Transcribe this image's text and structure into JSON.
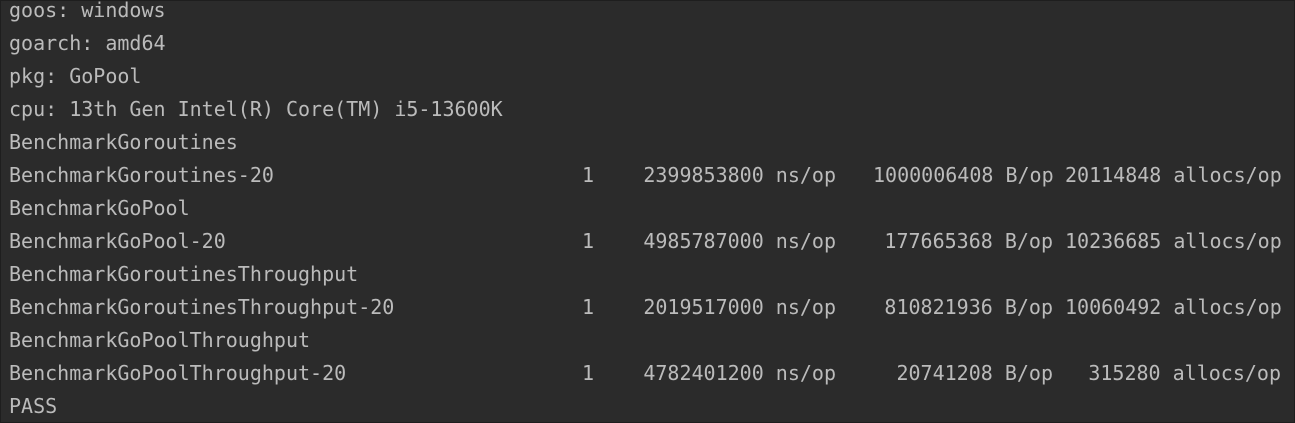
{
  "header": {
    "goos": "goos: windows",
    "goarch": "goarch: amd64",
    "pkg": "pkg: GoPool",
    "cpu": "cpu: 13th Gen Intel(R) Core(TM) i5-13600K"
  },
  "benchmarks": [
    {
      "title": "BenchmarkGoroutines",
      "name": "BenchmarkGoroutines-20",
      "iterations": "1",
      "ns_per_op": "2399853800 ns/op",
      "bytes_per_op": "1000006408 B/op",
      "allocs_per_op": "20114848 allocs/op"
    },
    {
      "title": "BenchmarkGoPool",
      "name": "BenchmarkGoPool-20",
      "iterations": "1",
      "ns_per_op": "4985787000 ns/op",
      "bytes_per_op": "177665368 B/op",
      "allocs_per_op": "10236685 allocs/op"
    },
    {
      "title": "BenchmarkGoroutinesThroughput",
      "name": "BenchmarkGoroutinesThroughput-20",
      "iterations": "1",
      "ns_per_op": "2019517000 ns/op",
      "bytes_per_op": "810821936 B/op",
      "allocs_per_op": "10060492 allocs/op"
    },
    {
      "title": "BenchmarkGoPoolThroughput",
      "name": "BenchmarkGoPoolThroughput-20",
      "iterations": "1",
      "ns_per_op": "4782401200 ns/op",
      "bytes_per_op": "20741208 B/op",
      "allocs_per_op": "315280 allocs/op"
    }
  ],
  "footer": {
    "status": "PASS"
  },
  "colors": {
    "background": "#2b2b2b",
    "text": "#bbbbbb"
  }
}
